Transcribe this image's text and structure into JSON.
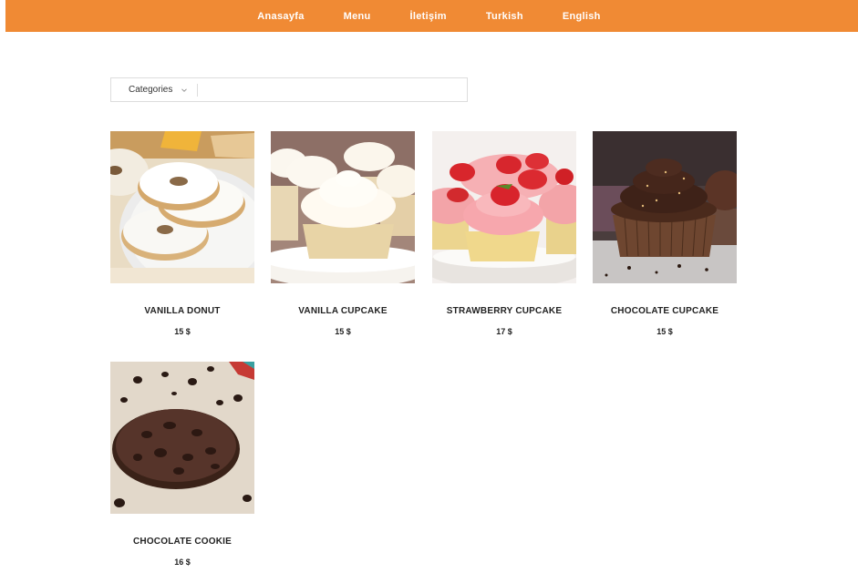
{
  "nav": {
    "items": [
      {
        "label": "Anasayfa"
      },
      {
        "label": "Menu"
      },
      {
        "label": "İletişim"
      },
      {
        "label": "Turkish"
      },
      {
        "label": "English"
      }
    ]
  },
  "filter": {
    "category_label": "Categories",
    "search_value": ""
  },
  "colors": {
    "brand": "#f08a34",
    "text": "#222222"
  },
  "products": [
    {
      "name": "VANILLA DONUT",
      "price": "15 $",
      "image": "vanilla-donut-photo"
    },
    {
      "name": "VANILLA CUPCAKE",
      "price": "15 $",
      "image": "vanilla-cupcake-photo"
    },
    {
      "name": "STRAWBERRY CUPCAKE",
      "price": "17 $",
      "image": "strawberry-cupcake-photo"
    },
    {
      "name": "CHOCOLATE CUPCAKE",
      "price": "15 $",
      "image": "chocolate-cupcake-photo"
    },
    {
      "name": "CHOCOLATE COOKIE",
      "price": "16 $",
      "image": "chocolate-cookie-photo"
    }
  ]
}
